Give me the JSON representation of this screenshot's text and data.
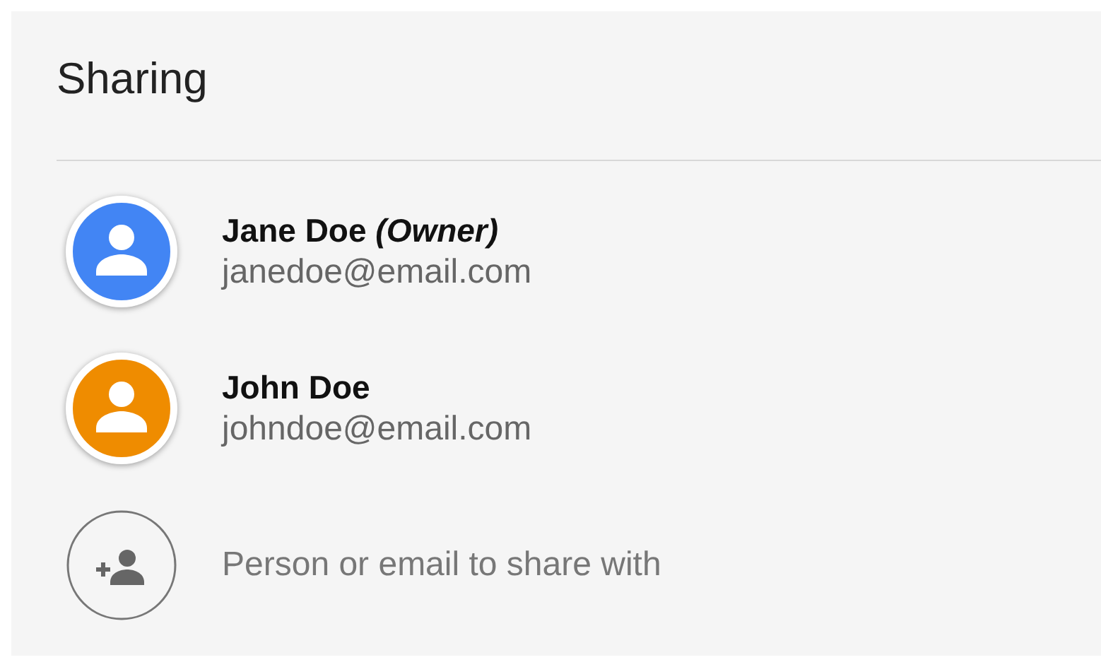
{
  "title": "Sharing",
  "people": [
    {
      "name": "Jane Doe *(Owner)*",
      "email": "janedoe@email.com",
      "color": "#4285f4"
    },
    {
      "name": "John Doe",
      "email": "johndoe@email.com",
      "color": "#ef8c00"
    }
  ],
  "invite": {
    "placeholder": "Person or email to share with"
  }
}
